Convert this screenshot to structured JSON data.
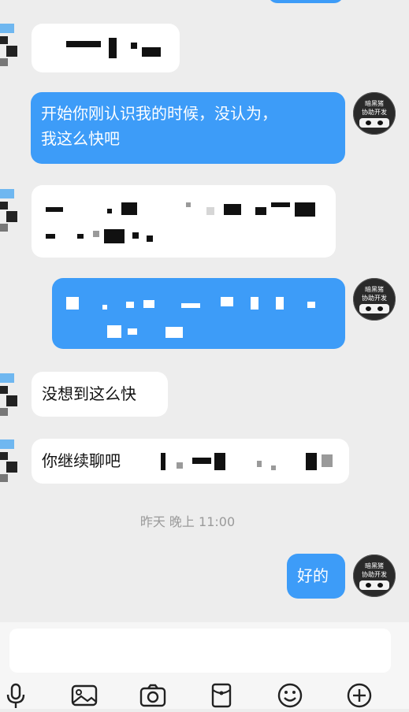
{
  "messages": [
    {
      "side": "left",
      "text": ""
    },
    {
      "side": "right",
      "text": "开始你刚认识我的时候，没认为，\n我这么快吧"
    },
    {
      "side": "left",
      "text": ""
    },
    {
      "side": "right",
      "text": ""
    },
    {
      "side": "left",
      "text": "没想到这么快"
    },
    {
      "side": "left",
      "text": "你继续聊吧"
    },
    {
      "side": "right",
      "text": "好的"
    }
  ],
  "timestamp": "昨天 晚上 11:00",
  "avatar_right": {
    "line1": "暗黑猪",
    "line2": "协助开发"
  },
  "toolbar": {
    "icons": [
      "microphone-icon",
      "image-icon",
      "camera-icon",
      "red-packet-icon",
      "emoji-icon",
      "plus-icon"
    ]
  },
  "colors": {
    "background": "#ededed",
    "my_bubble": "#3d9cf8",
    "their_bubble": "#ffffff"
  }
}
